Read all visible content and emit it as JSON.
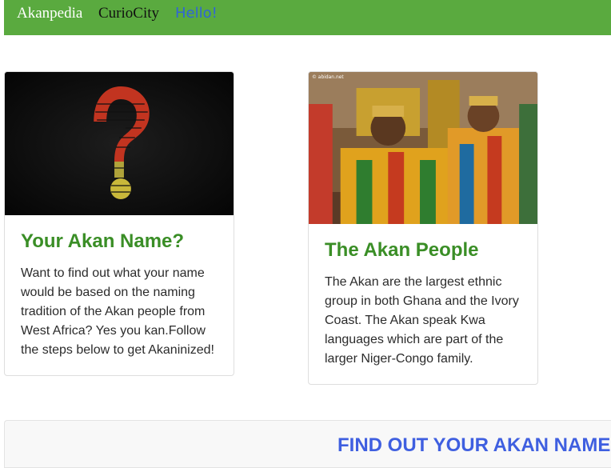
{
  "nav": {
    "brand": "Akanpedia",
    "link_curiocity": "CurioCity",
    "link_hello": "Hello!"
  },
  "cards": [
    {
      "image_name": "question-mark-word-cloud-image",
      "title": "Your Akan Name?",
      "text": "Want to find out what your name would be based on the naming tradition of the Akan people from West Africa? Yes you kan.Follow the steps below to get Akaninized!"
    },
    {
      "image_name": "akan-royalty-photo",
      "watermark": "© abidan.net",
      "title": "The Akan People",
      "text": "The Akan are the largest ethnic group in both Ghana and the Ivory Coast. The Akan speak Kwa languages which are part of the larger Niger-Congo family."
    }
  ],
  "form": {
    "title": "FIND OUT YOUR AKAN NAME"
  },
  "colors": {
    "navbar": "#5aaa3f",
    "card_title": "#3a8e26",
    "form_title": "#3f5fe0",
    "hello_link": "#3065d6"
  }
}
